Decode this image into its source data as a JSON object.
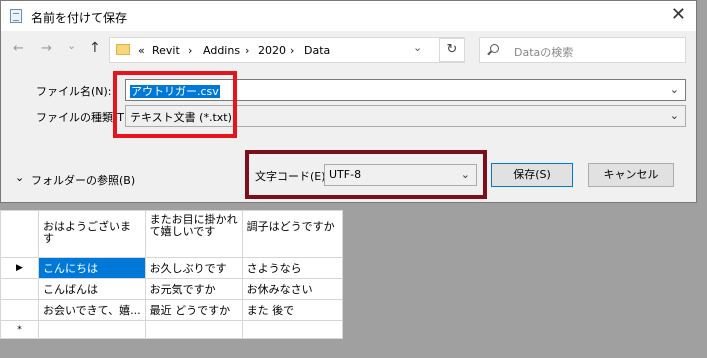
{
  "dialog": {
    "title": "名前を付けて保存",
    "close_glyph": "✕"
  },
  "nav": {
    "back": "←",
    "forward": "→",
    "dropdown": "⌄",
    "up": "↑"
  },
  "address": {
    "overflow": "«",
    "crumbs": [
      "Revit",
      "Addins",
      "2020",
      "Data"
    ],
    "separator": "›",
    "dropdown": "⌄",
    "refresh": "↻"
  },
  "search": {
    "placeholder": "Dataの検索"
  },
  "form": {
    "filename_label": "ファイル名(N):",
    "filename_value": "アウトリガー.csv",
    "filetype_label": "ファイルの種類(T):",
    "filetype_value": "テキスト文書 (*.txt)",
    "chevron": "⌄",
    "browse_label": "フォルダーの参照(B)",
    "browse_chevron": "⌄",
    "encoding_label": "文字コード(E):",
    "encoding_value": "UTF-8",
    "save_label": "保存(S)",
    "cancel_label": "キャンセル"
  },
  "grid": {
    "headers": [
      "おはようございます",
      "またお目に掛かれて嬉しいです",
      "調子はどうですか"
    ],
    "rows": [
      {
        "marker": "▶",
        "cells": [
          "こんにちは",
          "お久しぶりです",
          "さようなら"
        ]
      },
      {
        "marker": "",
        "cells": [
          "こんばんは",
          "お元気ですか",
          "お休みなさい"
        ]
      },
      {
        "marker": "",
        "cells": [
          "お会いできて、嬉...",
          "最近 どうですか",
          "また 後で"
        ]
      }
    ],
    "new_row_marker": "*"
  }
}
